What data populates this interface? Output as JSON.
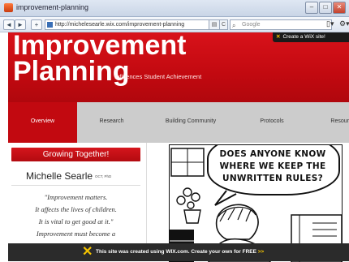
{
  "browser": {
    "tab_title": "improvement-planning",
    "url": "http://michelesearle.wix.com/improvement-planning",
    "search_placeholder": "Google",
    "back_label": "◄",
    "forward_label": "►",
    "add_label": "+",
    "refresh_label": "C"
  },
  "header": {
    "logo_line1": "Improvement",
    "logo_line2": "Planning",
    "tagline": "Influences Student Achievement",
    "wix_prompt": "Create a WiX site!"
  },
  "nav": {
    "items": [
      {
        "label": "Overview"
      },
      {
        "label": "Research"
      },
      {
        "label": "Building Community"
      },
      {
        "label": "Protocols"
      },
      {
        "label": "Resour"
      }
    ]
  },
  "sidebar": {
    "button_label": "Growing Together!",
    "name": "Michelle Searle",
    "credentials": "OCT, PhD",
    "quote_lines": [
      "\"Improvement matters.",
      "It affects the lives of children.",
      "It is vital to get good at it.\"",
      "Improvement must become a"
    ]
  },
  "comic": {
    "lines": [
      "DOES ANYONE KNOW",
      "WHERE WE KEEP THE",
      "UNWRITTEN RULES?"
    ]
  },
  "footer": {
    "message": "This site was created using WIX.com. Create your own for FREE",
    "arrows": ">>"
  }
}
